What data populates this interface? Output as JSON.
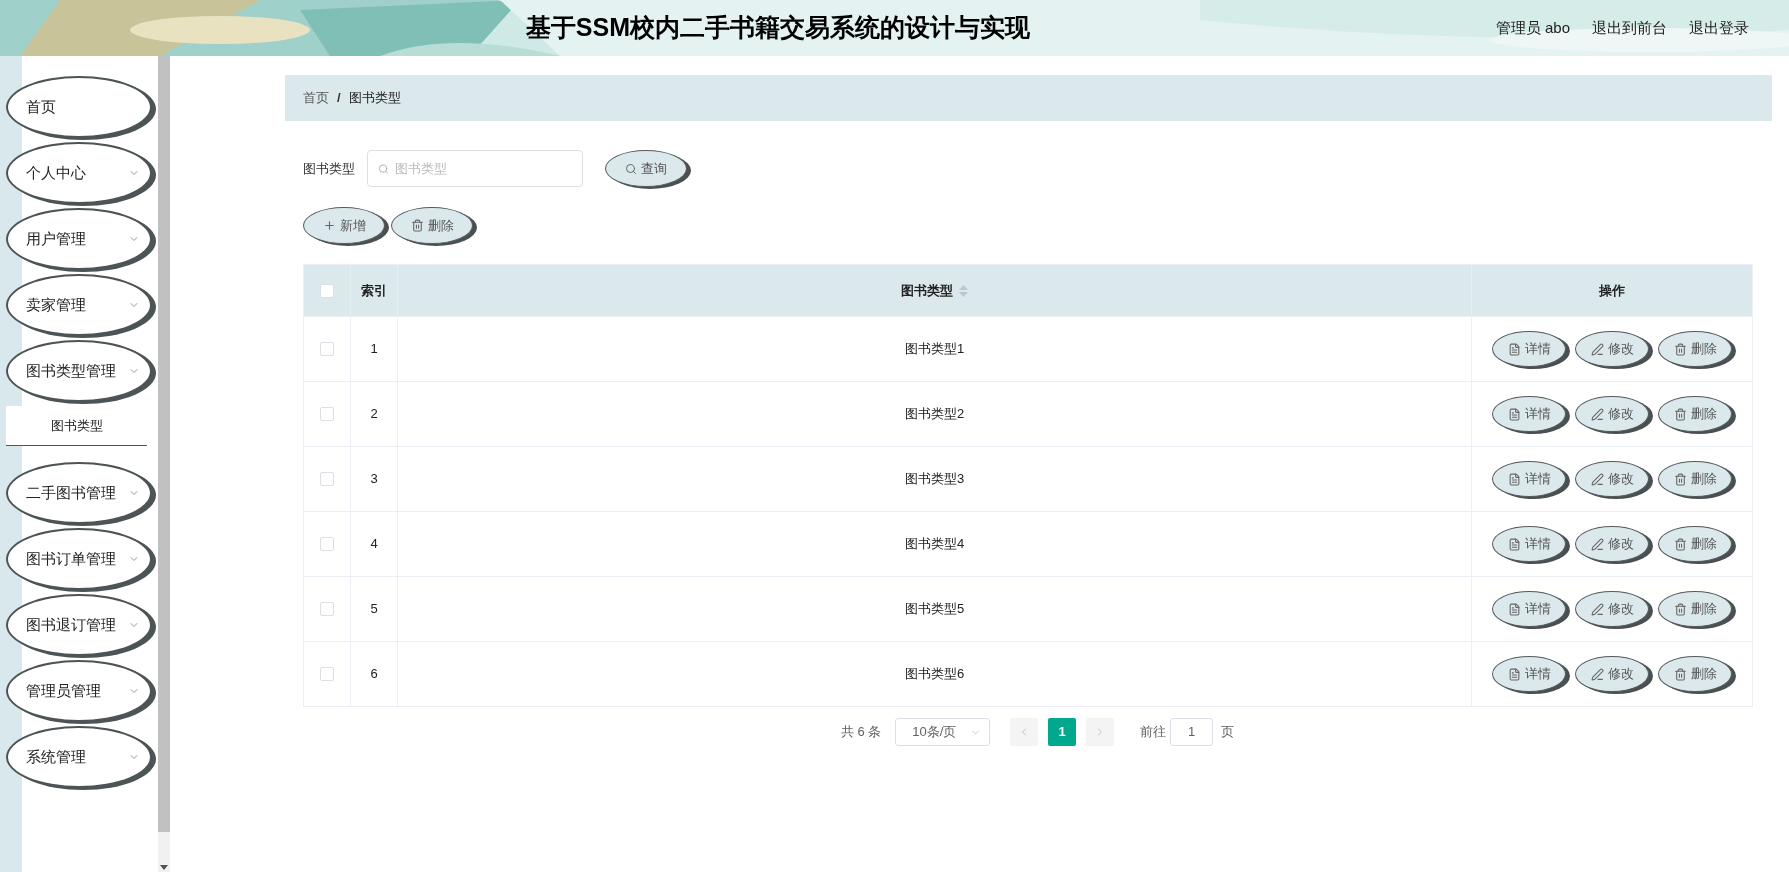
{
  "header": {
    "title": "基于SSM校内二手书籍交易系统的设计与实现",
    "links": [
      "管理员 abo",
      "退出到前台",
      "退出登录"
    ]
  },
  "sidebar": {
    "items": [
      {
        "label": "首页",
        "kind": "link"
      },
      {
        "label": "个人中心",
        "kind": "submenu"
      },
      {
        "label": "用户管理",
        "kind": "submenu"
      },
      {
        "label": "卖家管理",
        "kind": "submenu"
      },
      {
        "label": "图书类型管理",
        "kind": "submenu",
        "children": [
          {
            "label": "图书类型"
          }
        ]
      },
      {
        "label": "二手图书管理",
        "kind": "submenu"
      },
      {
        "label": "图书订单管理",
        "kind": "submenu"
      },
      {
        "label": "图书退订管理",
        "kind": "submenu"
      },
      {
        "label": "管理员管理",
        "kind": "submenu"
      },
      {
        "label": "系统管理",
        "kind": "submenu"
      }
    ]
  },
  "breadcrumb": {
    "items": [
      "首页",
      "图书类型"
    ],
    "separator": "/"
  },
  "search": {
    "label": "图书类型",
    "placeholder": "图书类型",
    "button": "查询"
  },
  "actions": [
    {
      "label": "新增",
      "kind": "add"
    },
    {
      "label": "删除",
      "kind": "delete"
    }
  ],
  "table": {
    "header_checked": false,
    "columns": [
      "索引",
      "图书类型",
      "操作"
    ],
    "rows": [
      {
        "checked": false,
        "index": "1",
        "type": "图书类型1",
        "actions": [
          {
            "label": "详情",
            "kind": "detail"
          },
          {
            "label": "修改",
            "kind": "edit"
          },
          {
            "label": "删除",
            "kind": "delete"
          }
        ]
      },
      {
        "checked": false,
        "index": "2",
        "type": "图书类型2",
        "actions": [
          {
            "label": "详情",
            "kind": "detail"
          },
          {
            "label": "修改",
            "kind": "edit"
          },
          {
            "label": "删除",
            "kind": "delete"
          }
        ]
      },
      {
        "checked": false,
        "index": "3",
        "type": "图书类型3",
        "actions": [
          {
            "label": "详情",
            "kind": "detail"
          },
          {
            "label": "修改",
            "kind": "edit"
          },
          {
            "label": "删除",
            "kind": "delete"
          }
        ]
      },
      {
        "checked": false,
        "index": "4",
        "type": "图书类型4",
        "actions": [
          {
            "label": "详情",
            "kind": "detail"
          },
          {
            "label": "修改",
            "kind": "edit"
          },
          {
            "label": "删除",
            "kind": "delete"
          }
        ]
      },
      {
        "checked": false,
        "index": "5",
        "type": "图书类型5",
        "actions": [
          {
            "label": "详情",
            "kind": "detail"
          },
          {
            "label": "修改",
            "kind": "edit"
          },
          {
            "label": "删除",
            "kind": "delete"
          }
        ]
      },
      {
        "checked": false,
        "index": "6",
        "type": "图书类型6",
        "actions": [
          {
            "label": "详情",
            "kind": "detail"
          },
          {
            "label": "修改",
            "kind": "edit"
          },
          {
            "label": "删除",
            "kind": "delete"
          }
        ]
      }
    ]
  },
  "pagination": {
    "total": "共 6 条",
    "page_size": "10条/页",
    "pages": [
      {
        "label": "1",
        "selected": true
      }
    ],
    "goto_label": "前往",
    "goto_value": "1",
    "goto_suffix": "页"
  }
}
